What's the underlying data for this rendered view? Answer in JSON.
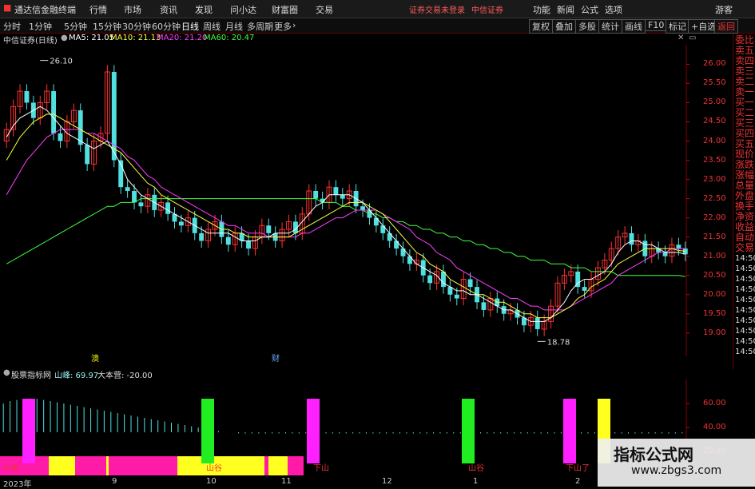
{
  "window": {
    "app_name": "通达信金融终端",
    "menu": [
      "行情",
      "市场",
      "资讯",
      "发现",
      "问小达",
      "财富圈",
      "交易"
    ],
    "login_status": "证券交易未登录",
    "broker": "中信证券",
    "right_menu": [
      "功能",
      "新闻",
      "公式",
      "选项"
    ],
    "guest": "游客"
  },
  "toolbar": {
    "periods": [
      "分时",
      "1分钟",
      "5分钟",
      "15分钟",
      "30分钟",
      "60分钟",
      "日线",
      "周线",
      "月线",
      "多周期",
      "更多"
    ],
    "active_period": "日线",
    "tools": [
      "复权",
      "叠加",
      "多股",
      "统计",
      "画线",
      "F10",
      "标记",
      "+自选",
      "返回"
    ]
  },
  "main_chart": {
    "stock_title": "中信证券(日线)",
    "ma_labels": [
      {
        "text": "MA5: 21.05",
        "color": "#ffffff"
      },
      {
        "text": "MA10: 21.13",
        "color": "#ffff40"
      },
      {
        "text": "MA20: 21.20",
        "color": "#ff40ff"
      },
      {
        "text": "MA60: 20.47",
        "color": "#40ff40"
      }
    ],
    "high_label": "26.10",
    "low_label": "18.78",
    "markers": [
      "澳",
      "财"
    ]
  },
  "right_panel": [
    "委比",
    "卖五",
    "卖四",
    "卖三",
    "卖二",
    "卖一",
    "买一",
    "买二",
    "买三",
    "买四",
    "买五",
    "现价",
    "涨跌",
    "涨幅",
    "总量",
    "外盘",
    "换手",
    "净资",
    "收益",
    "自动",
    "交易",
    "14:50",
    "14:50",
    "14:50",
    "14:50",
    "14:50",
    "14:50",
    "14:50",
    "14:50",
    "14:50",
    "14:50"
  ],
  "indicator": {
    "name": "股票指标网",
    "shanfeng": "山峰: 69.97",
    "dabenying": "大本营: -20.00",
    "labels": [
      "小魁",
      "山谷",
      "下山",
      "山谷",
      "下山了"
    ]
  },
  "chart_data": [
    {
      "type": "candlestick",
      "ylim": [
        18.6,
        26.3
      ],
      "y_ticks": [
        19.0,
        19.5,
        20.0,
        20.5,
        21.0,
        21.5,
        22.0,
        22.5,
        23.0,
        23.5,
        24.0,
        24.5,
        25.0,
        25.5,
        26.0
      ],
      "x_labels": [
        "2023年",
        "9",
        "10",
        "11",
        "12",
        "1",
        "2"
      ],
      "close": [
        24.3,
        24.9,
        25.3,
        25.0,
        24.6,
        25.0,
        25.3,
        24.2,
        24.0,
        24.5,
        24.8,
        23.9,
        23.4,
        24.0,
        24.2,
        25.8,
        23.5,
        22.8,
        22.7,
        22.4,
        22.3,
        22.6,
        22.2,
        22.4,
        22.1,
        21.9,
        21.8,
        22.0,
        21.6,
        21.4,
        21.7,
        21.9,
        21.5,
        21.3,
        21.6,
        21.4,
        21.2,
        21.5,
        21.8,
        21.6,
        21.4,
        21.7,
        21.9,
        21.6,
        22.1,
        22.7,
        22.5,
        22.4,
        22.8,
        22.6,
        22.5,
        22.7,
        22.3,
        22.2,
        22.0,
        21.8,
        21.6,
        21.4,
        21.2,
        21.0,
        20.8,
        20.9,
        20.5,
        20.3,
        20.6,
        20.2,
        20.0,
        19.9,
        20.4,
        20.2,
        19.8,
        19.6,
        19.9,
        19.7,
        19.5,
        19.6,
        19.4,
        19.2,
        19.4,
        19.1,
        19.3,
        19.7,
        20.3,
        20.5,
        20.6,
        20.2,
        20.1,
        20.4,
        20.7,
        20.9,
        21.2,
        21.5,
        21.6,
        21.3,
        21.4,
        21.0,
        21.2,
        21.1,
        21.0,
        21.3,
        21.2,
        21.05
      ],
      "ma5": [
        24.1,
        24.4,
        24.6,
        24.7,
        24.8,
        24.9,
        24.8,
        24.6,
        24.4,
        24.2,
        24.1,
        24.0,
        23.9,
        23.8,
        23.9,
        24.0,
        23.7,
        23.4,
        23.0,
        22.8,
        22.6,
        22.5,
        22.4,
        22.3,
        22.2,
        22.1,
        22.0,
        21.9,
        21.8,
        21.7,
        21.6,
        21.6,
        21.6,
        21.6,
        21.5,
        21.4,
        21.4,
        21.4,
        21.5,
        21.5,
        21.6,
        21.6,
        21.6,
        21.7,
        21.9,
        22.1,
        22.3,
        22.4,
        22.6,
        22.6,
        22.6,
        22.6,
        22.5,
        22.4,
        22.2,
        22.0,
        21.8,
        21.6,
        21.4,
        21.2,
        21.0,
        20.8,
        20.7,
        20.6,
        20.5,
        20.3,
        20.2,
        20.1,
        20.1,
        20.0,
        20.0,
        19.9,
        19.8,
        19.7,
        19.6,
        19.6,
        19.5,
        19.4,
        19.3,
        19.3,
        19.3,
        19.4,
        19.6,
        19.8,
        20.1,
        20.3,
        20.4,
        20.4,
        20.5,
        20.6,
        20.8,
        21.1,
        21.3,
        21.4,
        21.4,
        21.3,
        21.3,
        21.2,
        21.1,
        21.1,
        21.1,
        21.05
      ],
      "ma10": [
        23.5,
        23.8,
        24.1,
        24.3,
        24.5,
        24.6,
        24.7,
        24.7,
        24.6,
        24.5,
        24.4,
        24.3,
        24.2,
        24.1,
        24.0,
        23.9,
        23.8,
        23.7,
        23.5,
        23.3,
        23.1,
        22.9,
        22.8,
        22.6,
        22.5,
        22.4,
        22.3,
        22.2,
        22.1,
        22.0,
        21.9,
        21.8,
        21.7,
        21.7,
        21.6,
        21.6,
        21.5,
        21.5,
        21.5,
        21.5,
        21.5,
        21.5,
        21.5,
        21.6,
        21.7,
        21.8,
        21.9,
        22.0,
        22.1,
        22.2,
        22.3,
        22.4,
        22.4,
        22.4,
        22.3,
        22.2,
        22.1,
        21.9,
        21.7,
        21.5,
        21.3,
        21.1,
        21.0,
        20.8,
        20.7,
        20.6,
        20.4,
        20.3,
        20.2,
        20.1,
        20.0,
        20.0,
        19.9,
        19.8,
        19.8,
        19.7,
        19.6,
        19.5,
        19.5,
        19.4,
        19.4,
        19.4,
        19.5,
        19.6,
        19.7,
        19.9,
        20.0,
        20.2,
        20.3,
        20.4,
        20.6,
        20.8,
        20.9,
        21.0,
        21.1,
        21.2,
        21.2,
        21.2,
        21.2,
        21.2,
        21.15,
        21.13
      ],
      "ma20": [
        22.6,
        22.9,
        23.2,
        23.5,
        23.7,
        23.9,
        24.1,
        24.2,
        24.3,
        24.3,
        24.3,
        24.3,
        24.2,
        24.2,
        24.1,
        24.0,
        23.9,
        23.8,
        23.6,
        23.5,
        23.3,
        23.1,
        23.0,
        22.8,
        22.7,
        22.6,
        22.5,
        22.4,
        22.3,
        22.2,
        22.1,
        22.0,
        21.9,
        21.8,
        21.8,
        21.7,
        21.6,
        21.6,
        21.6,
        21.5,
        21.5,
        21.5,
        21.5,
        21.5,
        21.6,
        21.6,
        21.7,
        21.8,
        21.9,
        22.0,
        22.0,
        22.1,
        22.2,
        22.2,
        22.2,
        22.2,
        22.1,
        22.0,
        21.9,
        21.8,
        21.7,
        21.5,
        21.4,
        21.3,
        21.1,
        21.0,
        20.9,
        20.7,
        20.6,
        20.5,
        20.4,
        20.3,
        20.2,
        20.1,
        20.0,
        19.9,
        19.9,
        19.8,
        19.7,
        19.7,
        19.6,
        19.6,
        19.6,
        19.6,
        19.7,
        19.8,
        19.9,
        20.0,
        20.1,
        20.2,
        20.3,
        20.5,
        20.6,
        20.7,
        20.8,
        20.9,
        21.0,
        21.1,
        21.1,
        21.2,
        21.2,
        21.2
      ],
      "ma60": [
        20.8,
        20.9,
        21.0,
        21.1,
        21.2,
        21.3,
        21.4,
        21.5,
        21.6,
        21.7,
        21.8,
        21.9,
        22.0,
        22.1,
        22.2,
        22.3,
        22.3,
        22.4,
        22.4,
        22.4,
        22.5,
        22.5,
        22.5,
        22.5,
        22.5,
        22.5,
        22.5,
        22.5,
        22.5,
        22.5,
        22.5,
        22.5,
        22.5,
        22.5,
        22.5,
        22.5,
        22.5,
        22.5,
        22.5,
        22.5,
        22.5,
        22.5,
        22.5,
        22.5,
        22.5,
        22.5,
        22.5,
        22.4,
        22.4,
        22.4,
        22.3,
        22.3,
        22.2,
        22.2,
        22.1,
        22.1,
        22.0,
        22.0,
        21.9,
        21.9,
        21.8,
        21.8,
        21.7,
        21.7,
        21.6,
        21.6,
        21.5,
        21.5,
        21.4,
        21.4,
        21.3,
        21.3,
        21.2,
        21.2,
        21.1,
        21.1,
        21.0,
        21.0,
        20.9,
        20.9,
        20.9,
        20.8,
        20.8,
        20.8,
        20.7,
        20.7,
        20.7,
        20.6,
        20.6,
        20.6,
        20.6,
        20.5,
        20.5,
        20.5,
        20.5,
        20.5,
        20.5,
        20.5,
        20.5,
        20.5,
        20.5,
        20.47
      ]
    },
    {
      "type": "bar",
      "ylim": [
        0,
        80
      ],
      "y_ticks": [
        20.0,
        40.0,
        60.0
      ],
      "shanfeng": [
        60,
        62,
        63,
        64,
        64,
        64,
        63,
        62,
        61,
        60,
        59,
        58,
        57,
        56,
        55,
        54,
        53,
        52,
        51,
        50,
        49,
        48,
        47,
        46,
        45,
        44,
        43,
        42,
        41,
        40,
        39,
        38,
        37,
        36,
        36,
        35,
        35,
        35,
        35,
        35,
        35,
        35,
        35,
        35,
        35,
        35,
        35,
        35,
        35,
        35,
        35,
        35,
        35,
        35,
        35,
        35,
        35,
        35,
        35,
        35,
        35,
        35,
        35,
        35,
        35,
        35,
        35,
        35,
        35,
        35,
        35,
        35,
        35,
        35,
        35,
        35,
        35,
        35,
        35,
        35,
        35,
        35,
        35,
        35,
        35,
        35,
        35,
        35,
        35,
        35,
        35,
        35,
        35,
        35,
        35,
        35,
        35,
        35,
        35,
        35,
        35,
        35
      ],
      "magenta_zones": [
        [
          0,
          61
        ],
        [
          94,
          133
        ],
        [
          136,
          222
        ],
        [
          331,
          336
        ],
        [
          360,
          380
        ]
      ],
      "yellow_zones": [
        [
          61,
          94
        ],
        [
          133,
          136
        ],
        [
          222,
          331
        ],
        [
          336,
          360
        ]
      ]
    }
  ]
}
